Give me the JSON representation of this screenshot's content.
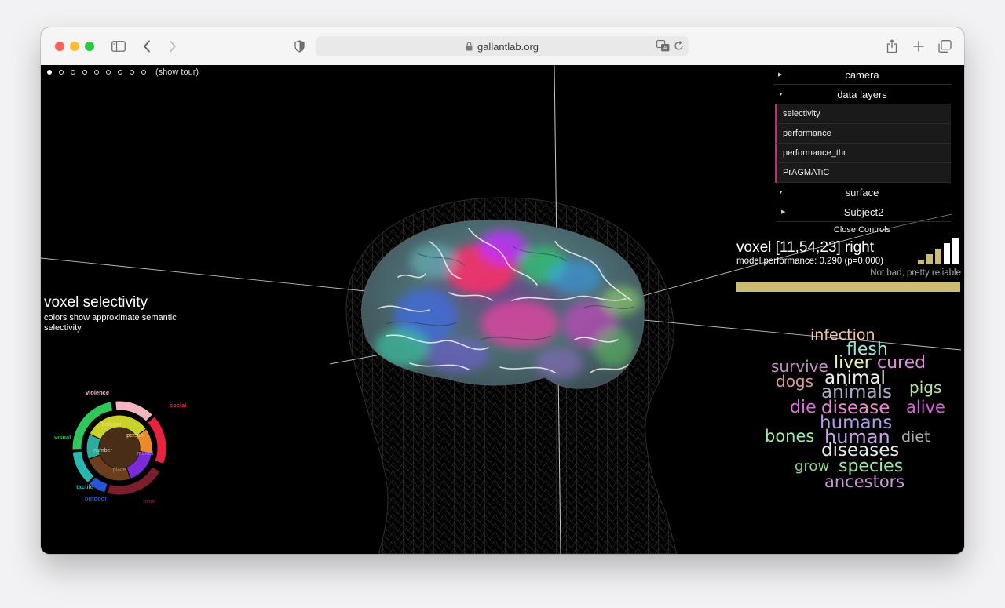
{
  "browser": {
    "url": "gallantlab.org",
    "icons": [
      "sidebar-icon",
      "back-icon",
      "forward-icon",
      "shield-icon",
      "lock-icon",
      "translate-icon",
      "reload-icon",
      "share-icon",
      "new-tab-icon",
      "tabs-icon"
    ]
  },
  "tour": {
    "dots": 9,
    "active_index": 0,
    "label": "(show tour)"
  },
  "controls": {
    "camera": "camera",
    "data_layers": "data layers",
    "layers": [
      "selectivity",
      "performance",
      "performance_thr",
      "PrAGMATiC"
    ],
    "surface": "surface",
    "subject": "Subject2",
    "close": "Close Controls",
    "accent_color": "#e2216e"
  },
  "voxel": {
    "title": "voxel [11,54,23] right",
    "performance": "model performance: 0.290 (p=0.000)",
    "reliability": "Not bad, pretty reliable",
    "bar_color": "#cdbb72",
    "signal_level": 3,
    "signal_bars": 5
  },
  "selectivity": {
    "title": "voxel selectivity",
    "subtitle": "colors show approximate semantic selectivity"
  },
  "legend_wheel": {
    "inner": [
      {
        "label": "bodypart",
        "color": "#c9d22a"
      },
      {
        "label": "person",
        "color": "#ea8a2a"
      },
      {
        "label": "mental",
        "color": "#7a2ad8"
      },
      {
        "label": "place",
        "color": "#6b3f1e"
      },
      {
        "label": "number",
        "color": "#2eac9a"
      }
    ],
    "outer": [
      {
        "label": "violence",
        "color": "#f3b6c0"
      },
      {
        "label": "social",
        "color": "#e8223f"
      },
      {
        "label": "time",
        "color": "#7a1f2b"
      },
      {
        "label": "outdoor",
        "color": "#2a54d6"
      },
      {
        "label": "tactile",
        "color": "#2ab7b0"
      },
      {
        "label": "visual",
        "color": "#30c75a"
      }
    ]
  },
  "word_cloud": [
    {
      "text": "infection",
      "color": "#f1c6a9"
    },
    {
      "text": "flesh",
      "color": "#9fe8dc"
    },
    {
      "text": "survive",
      "color": "#c98fc4"
    },
    {
      "text": "liver",
      "color": "#e9f0b0"
    },
    {
      "text": "cured",
      "color": "#dd8de0"
    },
    {
      "text": "dogs",
      "color": "#d89a9a"
    },
    {
      "text": "animal",
      "color": "#eeeeee"
    },
    {
      "text": "pigs",
      "color": "#b9e0a0"
    },
    {
      "text": "animals",
      "color": "#a9b0c6"
    },
    {
      "text": "die",
      "color": "#e06de0"
    },
    {
      "text": "disease",
      "color": "#e98ad0"
    },
    {
      "text": "alive",
      "color": "#e05ce0"
    },
    {
      "text": "humans",
      "color": "#b49be8"
    },
    {
      "text": "bones",
      "color": "#9ae8a8"
    },
    {
      "text": "human",
      "color": "#c9a1e8"
    },
    {
      "text": "diet",
      "color": "#b0b0b0"
    },
    {
      "text": "diseases",
      "color": "#e8e8e8"
    },
    {
      "text": "grow",
      "color": "#8ed08e"
    },
    {
      "text": "species",
      "color": "#9ae8a8"
    },
    {
      "text": "ancestors",
      "color": "#c79ad6"
    }
  ]
}
